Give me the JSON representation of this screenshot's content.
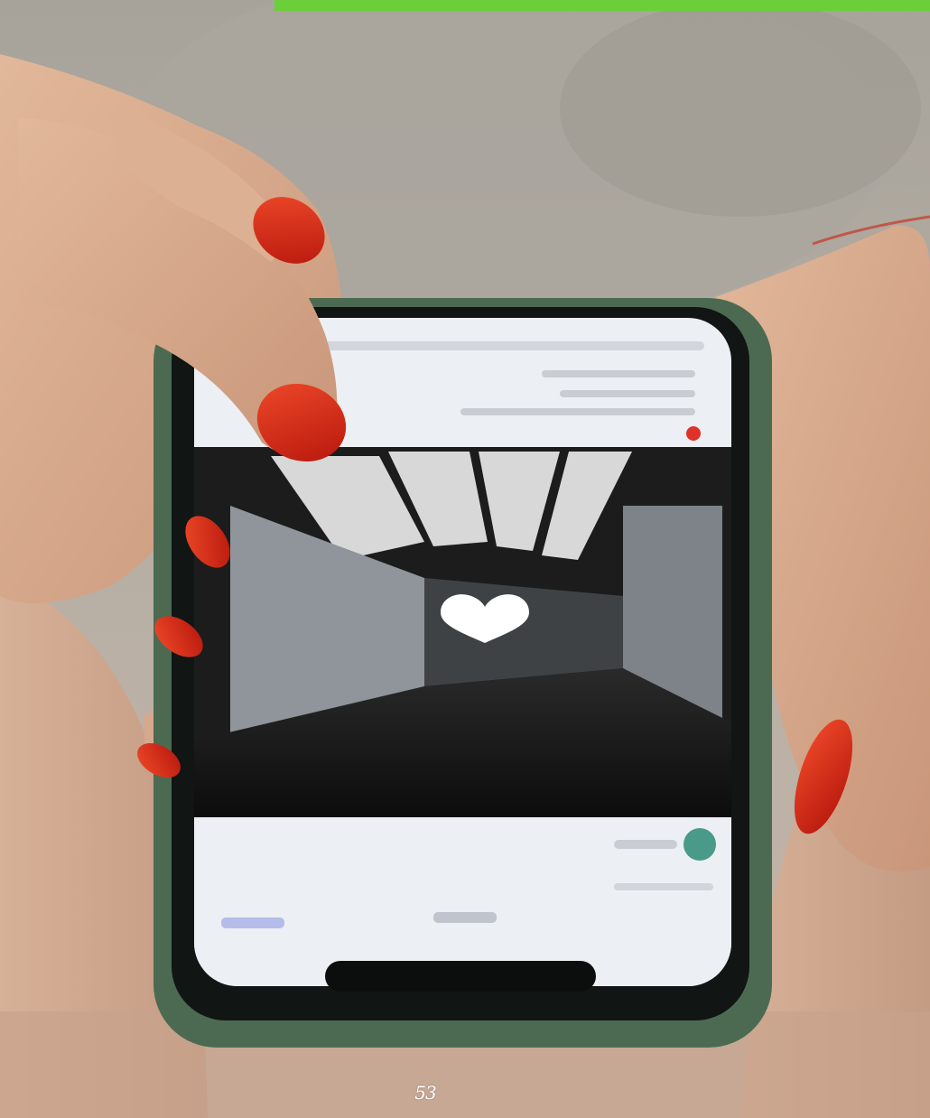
{
  "page": {
    "page_number": "53",
    "accent_color": "#6bcf3a"
  },
  "photo": {
    "subject_icons": [
      "hand",
      "smartphone",
      "heart-icon",
      "red-nail-polish"
    ]
  }
}
